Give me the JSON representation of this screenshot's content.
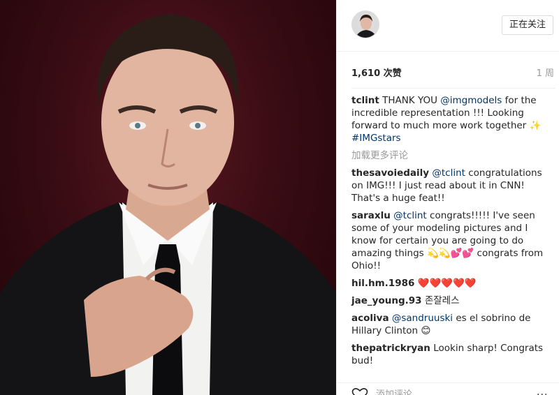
{
  "header": {
    "follow_label": "正在关注"
  },
  "stats": {
    "likes": "1,610 次赞",
    "time": "1 周"
  },
  "caption": {
    "user": "tclint",
    "text_1": " THANK YOU ",
    "mention": "@imgmodels",
    "text_2": " for the incredible representation !!! Looking forward to much more work together ✨ ",
    "hashtag": "#IMGstars"
  },
  "load_more": "加载更多评论",
  "comments": [
    {
      "user": "thesavoiedaily",
      "mention": "@tclint",
      "text": " congratulations on IMG!!! I just read about it in CNN! That's a huge feat!!"
    },
    {
      "user": "saraxlu",
      "mention": "@tclint",
      "text": " congrats!!!!! I've seen some of your modeling pictures and I know for certain you are going to do amazing things 💫💫💕💕 congrats from Ohio!!"
    },
    {
      "user": "hil.hm.1986",
      "mention": "",
      "text": " ❤️❤️❤️❤️❤️"
    },
    {
      "user": "jae_young.93",
      "mention": "",
      "text": " 존잘레스"
    },
    {
      "user": "acoliva",
      "mention": "@sandruuski",
      "text": " es el sobrino de Hillary Clinton 😊"
    },
    {
      "user": "thepatrickryan",
      "mention": "",
      "text": " Lookin sharp! Congrats bud!"
    }
  ],
  "footer": {
    "add_comment_placeholder": "添加评论...",
    "more_icon": "···"
  },
  "icons": {
    "like": "heart-outline-icon",
    "more": "ellipsis-icon"
  },
  "colors": {
    "mention": "#003569",
    "muted": "#999999",
    "background_photo": "#3a0c14"
  }
}
